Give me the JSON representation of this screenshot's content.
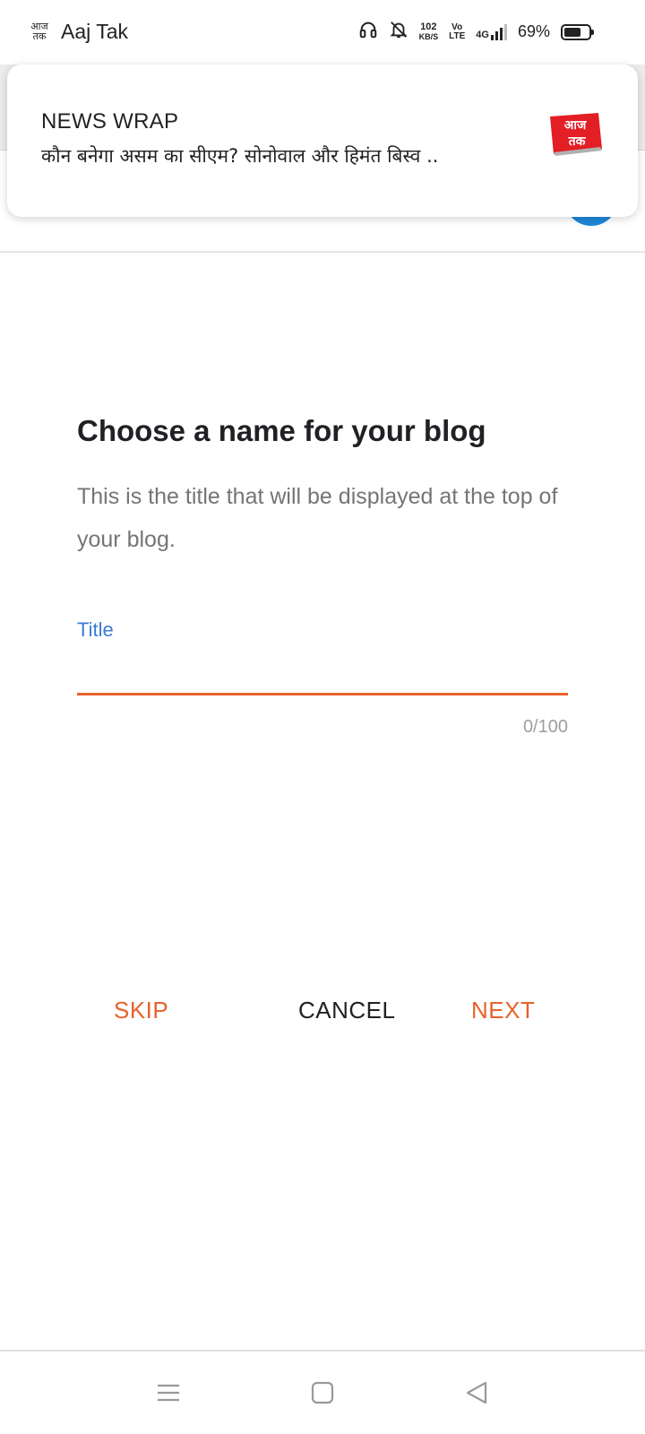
{
  "status_bar": {
    "app_icon_text": "आज तक",
    "app_name": "Aaj Tak",
    "speed_value": "102",
    "speed_unit": "KB/S",
    "volte_top": "Vo",
    "volte_bottom": "LTE",
    "network_type": "4G",
    "battery_percent": "69%",
    "battery_level": 0.69,
    "icons": [
      "headphones-icon",
      "bell-muted-icon",
      "signal-icon",
      "battery-icon"
    ]
  },
  "notification": {
    "title": "NEWS WRAP",
    "body": "कौन बनेगा असम का सीएम? सोनोवाल और हिमंत बिस्व ..",
    "logo_text": "आज तक",
    "logo_color": "#e31e24"
  },
  "main": {
    "heading": "Choose a name for your blog",
    "description": "This is the title that will be displayed at the top of your blog.",
    "field_label": "Title",
    "title_value": "",
    "counter": "0/100"
  },
  "actions": {
    "skip_label": "SKIP",
    "cancel_label": "CANCEL",
    "next_label": "NEXT"
  },
  "colors": {
    "accent": "#e8622c",
    "label_blue": "#3b7bd6",
    "fab_blue": "#1e88d8"
  }
}
